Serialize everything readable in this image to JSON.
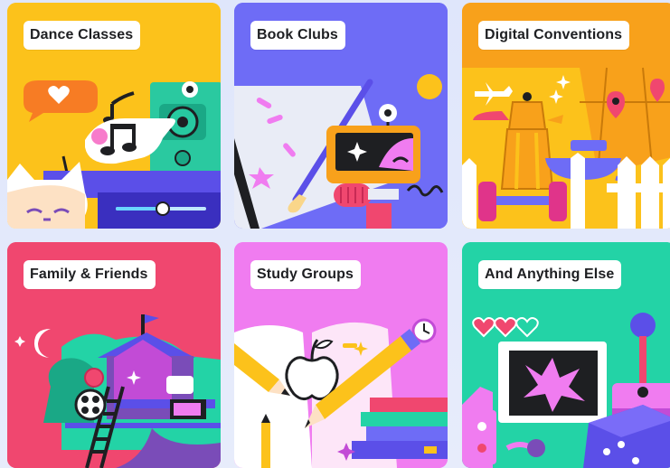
{
  "cards": [
    {
      "title": "Dance Classes",
      "bg": "#fcc21b"
    },
    {
      "title": "Book Clubs",
      "bg": "#6e6cf6"
    },
    {
      "title": "Digital Conventions",
      "bg": "#f8a11b"
    },
    {
      "title": "Family & Friends",
      "bg": "#f0476f"
    },
    {
      "title": "Study Groups",
      "bg": "#f07cf0"
    },
    {
      "title": "And Anything Else",
      "bg": "#23d3a6"
    }
  ],
  "colors": {
    "page_bg": "#e3e8fb",
    "pill_bg": "#ffffff",
    "pill_text": "#1e1f22"
  },
  "icons": {
    "card1": [
      "chat-heart-icon",
      "music-note-icon",
      "speaker-icon",
      "cat-icon",
      "volume-slider-icon"
    ],
    "card2": [
      "paintbrush-icon",
      "computer-monitor-icon",
      "sparkle-icon",
      "microphone-icon"
    ],
    "card3": [
      "airplane-icon",
      "map-pin-icon",
      "coffee-pot-icon",
      "teacup-icon",
      "dumbbell-icon"
    ],
    "card4": [
      "moon-icon",
      "treehouse-icon",
      "ladder-icon",
      "film-reel-icon"
    ],
    "card5": [
      "open-book-icon",
      "pencil-icon",
      "apple-icon",
      "clock-icon",
      "book-stack-icon"
    ],
    "card6": [
      "heart-icon",
      "tv-screen-icon",
      "game-controller-icon",
      "joystick-icon",
      "dice-icon"
    ]
  }
}
